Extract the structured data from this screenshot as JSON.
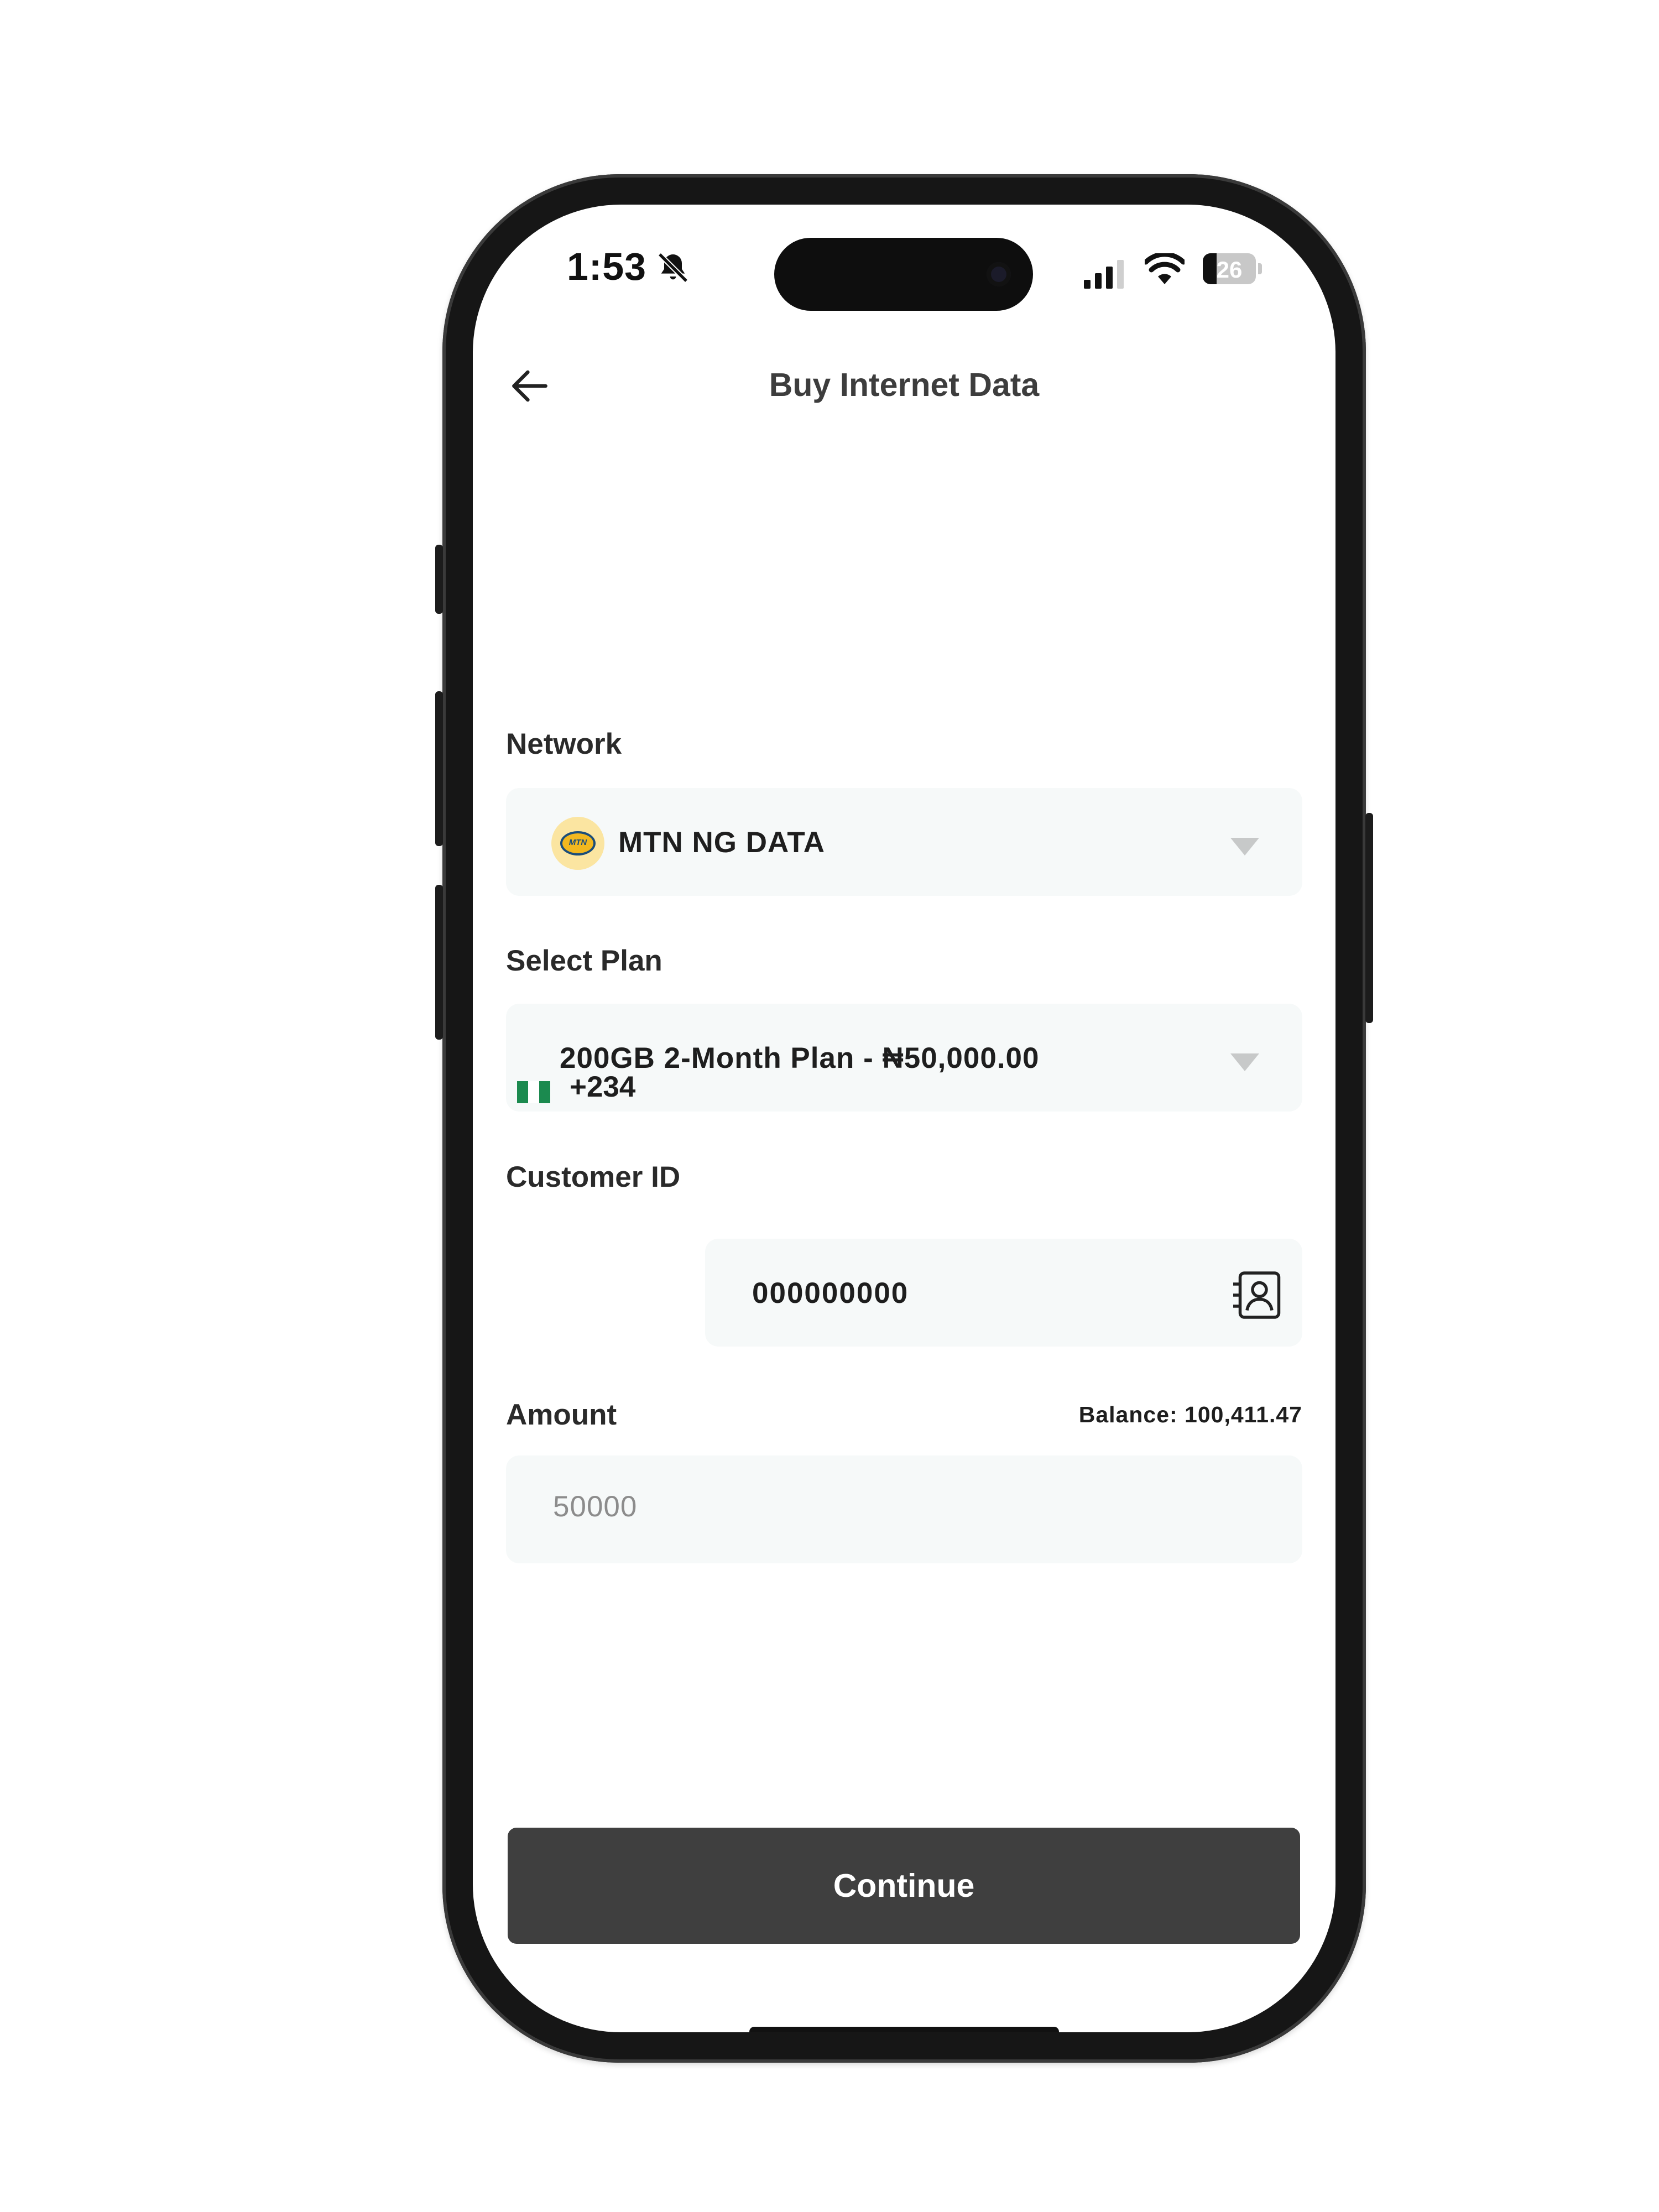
{
  "status_bar": {
    "time": "1:53",
    "battery": "26"
  },
  "header": {
    "title": "Buy Internet Data"
  },
  "network": {
    "label": "Network",
    "selected": "MTN NG DATA",
    "logo_text": "MTN"
  },
  "plan": {
    "label": "Select Plan",
    "selected": "200GB 2-Month Plan - ₦50,000.00"
  },
  "customer": {
    "label": "Customer ID",
    "dial_code": "+234",
    "phone_value": "000000000"
  },
  "amount": {
    "label": "Amount",
    "balance": "Balance: 100,411.47",
    "value": "50000"
  },
  "actions": {
    "continue_label": "Continue"
  },
  "icons": {
    "back": "arrow-left",
    "mute": "bell-slash",
    "contacts": "contact-book",
    "caret": "triangle-down"
  },
  "colors": {
    "button": "#3f3f3f",
    "field_bg": "#f6f9f9",
    "flag_green": "#1b8a4f"
  }
}
